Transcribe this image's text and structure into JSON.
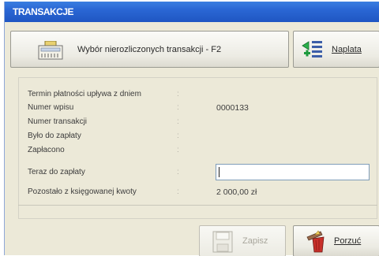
{
  "window": {
    "title": "TRANSAKCJE"
  },
  "toolbar": {
    "select_button_label": "Wybór nierozliczonych transakcji - F2",
    "payment_button_label": "Naplata"
  },
  "details": {
    "rows": [
      {
        "label": "Termin płatności upływa z dniem",
        "value": ""
      },
      {
        "label": "Numer wpisu",
        "value": "0000133"
      },
      {
        "label": "Numer transakcji",
        "value": ""
      },
      {
        "label": "Było do zapłaty",
        "value": ""
      },
      {
        "label": "Zapłacono",
        "value": ""
      },
      {
        "label": "Teraz do zapłaty",
        "value": ""
      },
      {
        "label": "Pozostało z księgowanej kwoty",
        "value": "2 000,00 zł"
      }
    ],
    "separator": ":"
  },
  "footer": {
    "save_button_label": "Zapisz",
    "cancel_button_label": "Porzuć"
  }
}
